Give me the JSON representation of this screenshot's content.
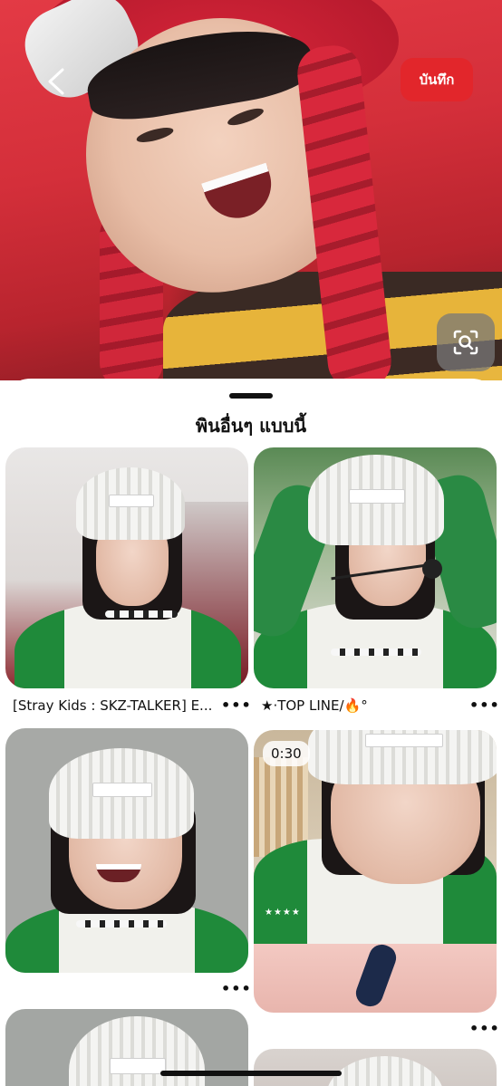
{
  "header": {
    "back_icon": "chevron-left-icon",
    "save_label": "บันทึก",
    "lens_icon": "visual-search-icon"
  },
  "section": {
    "title": "พินอื่นๆ แบบนี้"
  },
  "pins": [
    {
      "caption": "[Stray Kids : SKZ-TALKER] E...",
      "more": "•••"
    },
    {
      "caption": "★·TOP LINE/🔥°",
      "more": "•••"
    },
    {
      "caption": "",
      "more": "•••"
    },
    {
      "caption": "",
      "more": "•••",
      "duration": "0:30",
      "overlay_text": "★★★★"
    },
    {
      "caption": ""
    },
    {
      "caption": ""
    }
  ],
  "colors": {
    "save_button": "#e2262b",
    "sheet_bg": "#ffffff",
    "text": "#111111"
  }
}
